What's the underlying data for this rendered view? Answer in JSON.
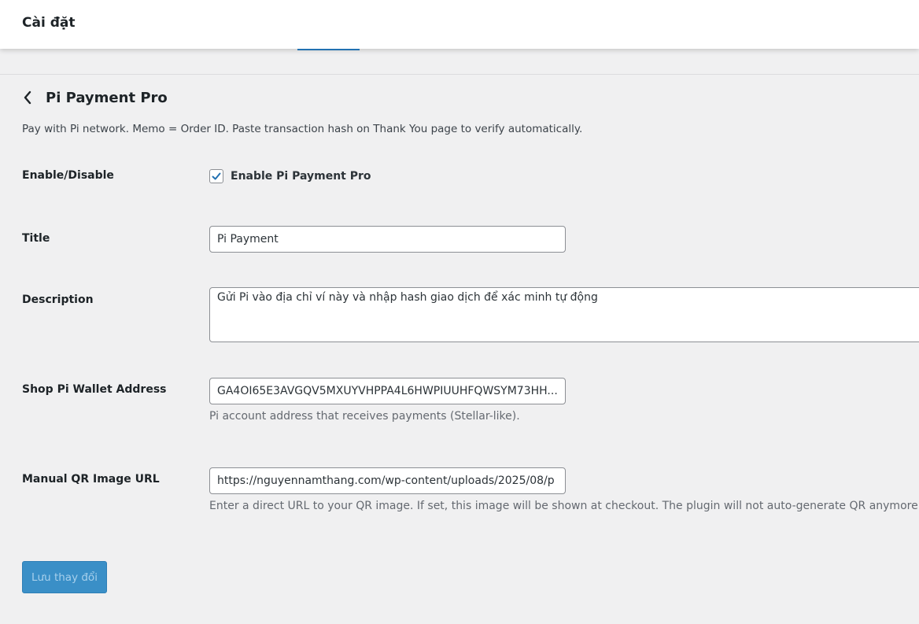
{
  "header": {
    "title": "Cài đặt"
  },
  "gateway": {
    "title": "Pi Payment Pro",
    "intro": "Pay with Pi network. Memo = Order ID. Paste transaction hash on Thank You page to verify automatically."
  },
  "fields": {
    "enable": {
      "label": "Enable/Disable",
      "checkbox_label": "Enable Pi Payment Pro",
      "checked": true
    },
    "title": {
      "label": "Title",
      "value": "Pi Payment"
    },
    "description": {
      "label": "Description",
      "value": "Gửi Pi vào địa chỉ ví này và nhập hash giao dịch để xác minh tự động"
    },
    "wallet": {
      "label": "Shop Pi Wallet Address",
      "value": "GA4OI65E3AVGQV5MXUYVHPPA4L6HWPIUUHFQWSYM73HH...",
      "help": "Pi account address that receives payments (Stellar-like)."
    },
    "qr": {
      "label": "Manual QR Image URL",
      "value": "https://nguyennamthang.com/wp-content/uploads/2025/08/p",
      "help": "Enter a direct URL to your QR image. If set, this image will be shown at checkout. The plugin will not auto-generate QR anymore."
    }
  },
  "actions": {
    "save_label": "Lưu thay đổi"
  },
  "icons": {
    "back": "chevron-left-icon",
    "check": "checkmark-icon"
  },
  "colors": {
    "accent": "#2271b1",
    "button_bg": "#3a8fc7",
    "button_text": "#a7d0ec"
  }
}
